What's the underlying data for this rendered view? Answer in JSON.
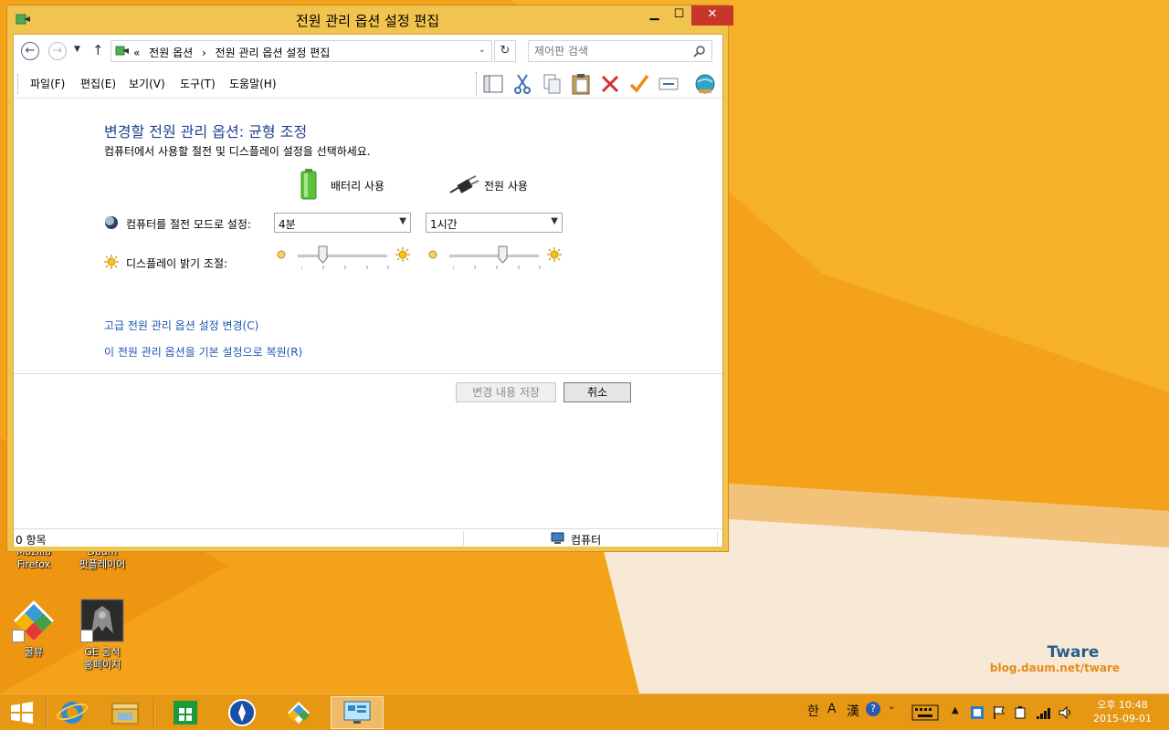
{
  "window": {
    "title": "전원 관리 옵션 설정 편집",
    "controls": {
      "minimize": "▁",
      "maximize": "☐",
      "close": "✕"
    }
  },
  "address": {
    "back_icon": "back-arrow-icon",
    "forward_icon": "forward-arrow-icon",
    "overflow": "«",
    "breadcrumbs": [
      "전원 옵션",
      "›",
      "전원 관리 옵션 설정 편집"
    ],
    "search_placeholder": "제어판 검색"
  },
  "menu": {
    "items": [
      "파일(F)",
      "편집(E)",
      "보기(V)",
      "도구(T)",
      "도움말(H)"
    ]
  },
  "toolbar": {
    "buttons": [
      "layout-icon",
      "cut-icon",
      "copy-icon",
      "paste-icon",
      "delete-icon",
      "properties-check-icon",
      "rename-icon",
      "globe-icon"
    ]
  },
  "content": {
    "heading": "변경할 전원 관리 옵션: 균형 조정",
    "subheading": "컴퓨터에서 사용할 절전 및 디스플레이 설정을 선택하세요.",
    "columns": {
      "battery": "배터리 사용",
      "plugged": "전원 사용"
    },
    "sleep": {
      "label": "컴퓨터를 절전 모드로 설정:",
      "battery_value": "4분",
      "plugged_value": "1시간"
    },
    "brightness": {
      "label": "디스플레이 밝기 조절:",
      "battery_level": 0.28,
      "plugged_level": 0.6
    },
    "links": {
      "advanced": "고급 전원 관리 옵션 설정 변경(C)",
      "restore": "이 전원 관리 옵션을 기본 설정으로 복원(R)"
    },
    "buttons": {
      "save": "변경 내용 저장",
      "cancel": "취소"
    }
  },
  "statusbar": {
    "count": "0 항목",
    "zone": "컴퓨터"
  },
  "desktop": {
    "icons": [
      {
        "label_line1": "Mozilla",
        "label_line2": "Firefox"
      },
      {
        "label_line1": "Daum",
        "label_line2": "팟플레이어"
      },
      {
        "label_line1": "꿀뷰",
        "label_line2": ""
      },
      {
        "label_line1": "GE 공식",
        "label_line2": "홈페이지"
      }
    ],
    "watermark_title": "Tware",
    "watermark_url": "blog.daum.net/tware"
  },
  "taskbar": {
    "tray": {
      "ime_hangul": "한",
      "ime_mode": "A",
      "ime_hanja": "漢"
    },
    "time": "오후 10:48",
    "date": "2015-09-01"
  },
  "colors": {
    "desktop": "#f3a21a",
    "window_frame": "#f1c34f",
    "close_button": "#c7362b",
    "heading": "#1e3f8f",
    "link": "#1e56b0",
    "taskbar": "#e69714"
  }
}
